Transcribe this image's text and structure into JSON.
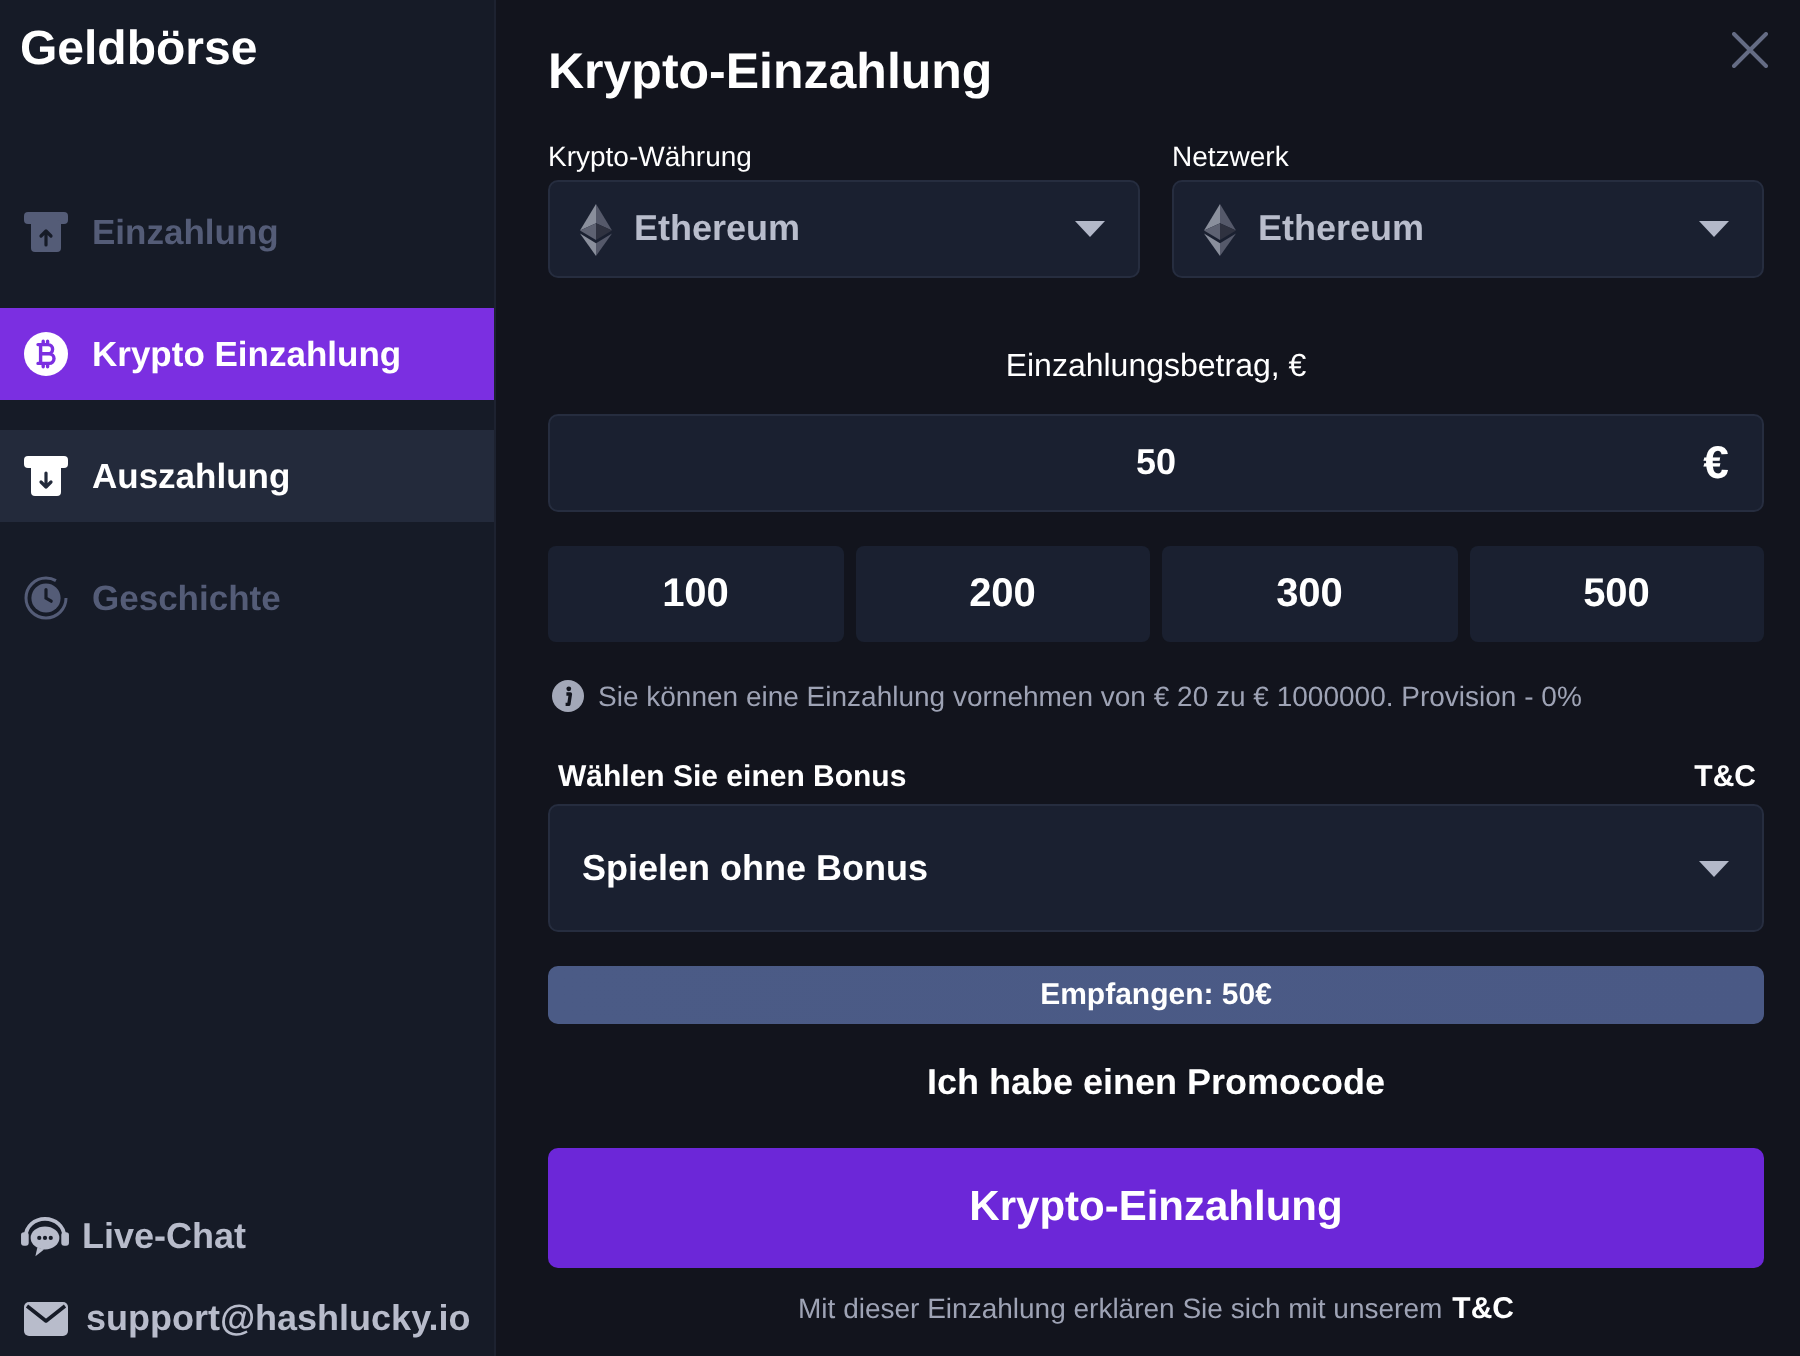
{
  "sidebar": {
    "title": "Geldbörse",
    "items": [
      {
        "label": "Einzahlung",
        "selected": false,
        "hovered": false
      },
      {
        "label": "Krypto Einzahlung",
        "selected": true,
        "hovered": false
      },
      {
        "label": "Auszahlung",
        "selected": false,
        "hovered": true
      },
      {
        "label": "Geschichte",
        "selected": false,
        "hovered": false
      }
    ],
    "contact_links": [
      {
        "label": "Live-Chat"
      },
      {
        "label": "support@hashlucky.io"
      }
    ]
  },
  "dialog": {
    "title": "Krypto-Einzahlung",
    "selects": [
      {
        "label": "Krypto-Währung",
        "value": "Ethereum"
      },
      {
        "label": "Netzwerk",
        "value": "Ethereum"
      }
    ],
    "amount": {
      "label": "Einzahlungsbetrag, €",
      "value": "50",
      "currency": "€"
    },
    "quick_amounts": [
      "100",
      "200",
      "300",
      "500"
    ],
    "info": "Sie können eine Einzahlung vornehmen von € 20 zu € 1000000. Provision - 0%",
    "bonus": {
      "label": "Wählen Sie einen Bonus",
      "terms_link": "T&C",
      "value": "Spielen ohne Bonus"
    },
    "received": "Empfangen: 50€",
    "promo_link": "Ich habe einen Promocode",
    "submit_button": "Krypto-Einzahlung",
    "footer": {
      "text": "Mit dieser Einzahlung erklären Sie sich mit unserem",
      "link": "T&C"
    }
  }
}
